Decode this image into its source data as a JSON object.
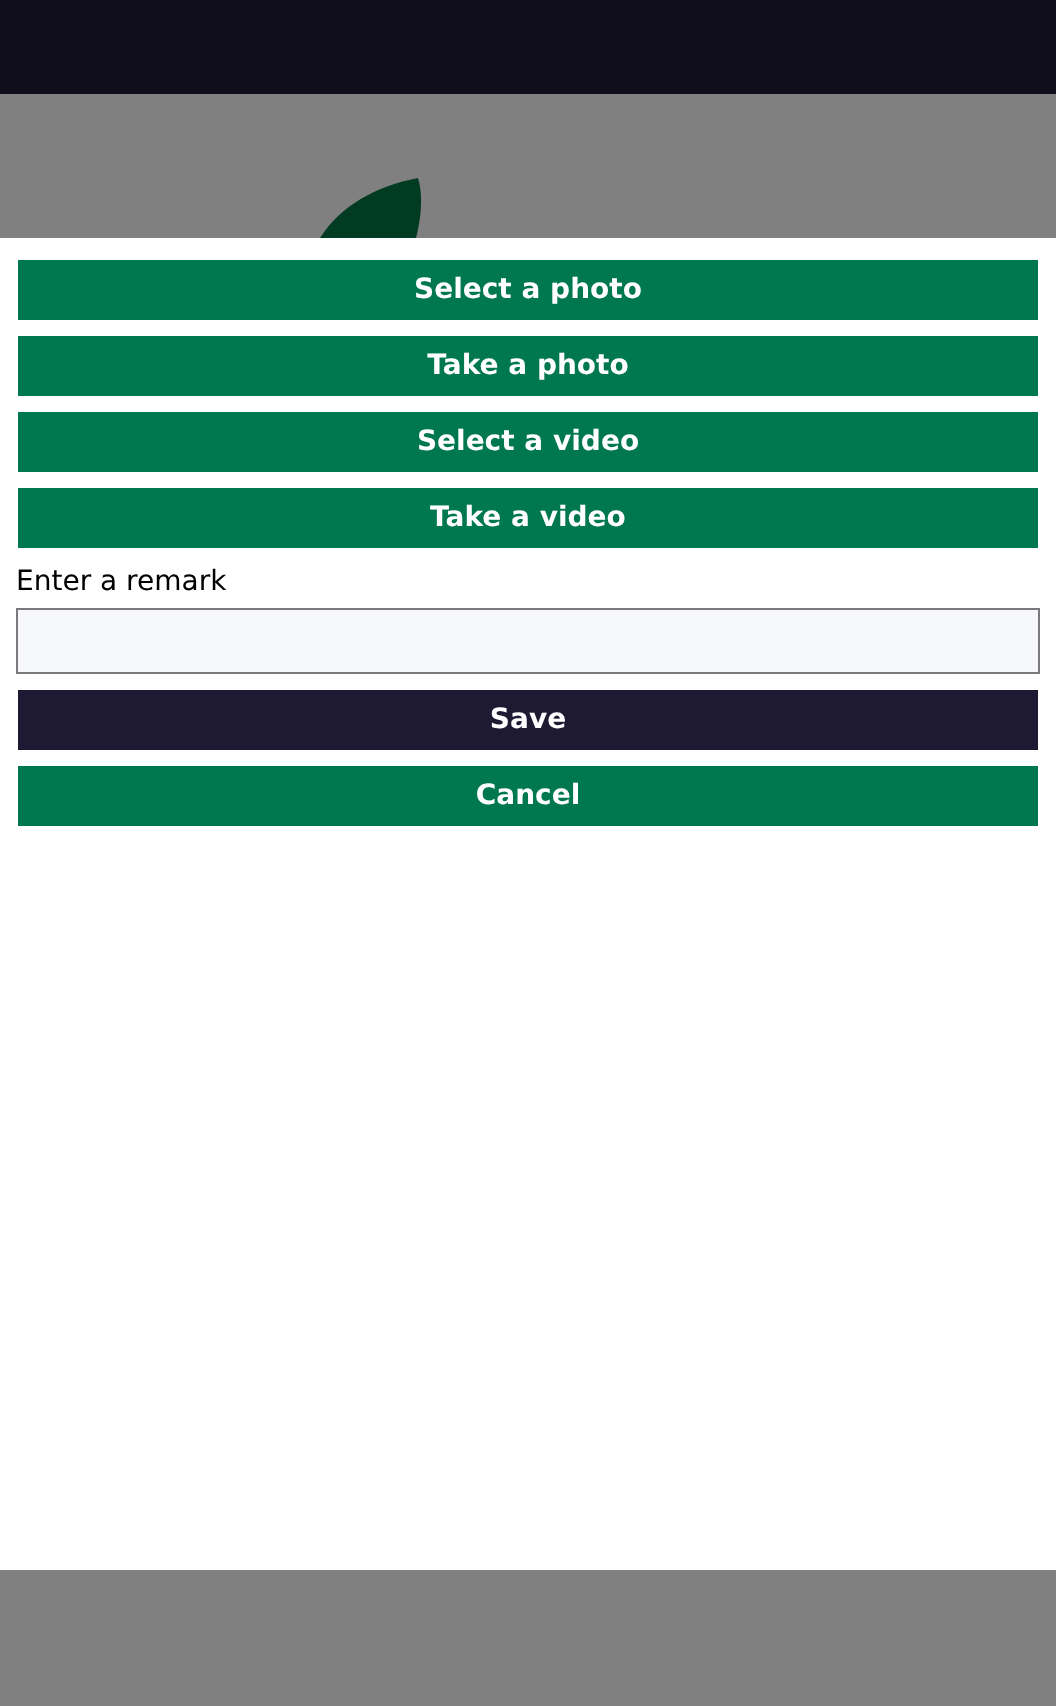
{
  "actions": [
    {
      "label": "Select a photo",
      "kind": "primary"
    },
    {
      "label": "Take a photo",
      "kind": "primary"
    },
    {
      "label": "Select a video",
      "kind": "primary"
    },
    {
      "label": "Take a video",
      "kind": "primary"
    }
  ],
  "remark": {
    "label": "Enter a remark"
  },
  "buttons": [
    {
      "label": "Save",
      "kind": "dark"
    },
    {
      "label": "Cancel",
      "kind": "primary"
    }
  ]
}
